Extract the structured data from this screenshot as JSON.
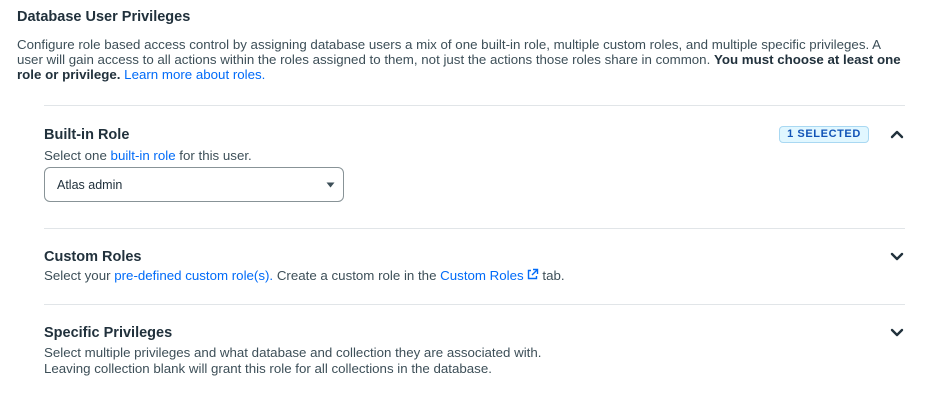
{
  "page": {
    "title": "Database User Privileges",
    "description_part1": "Configure role based access control by assigning database users a mix of one built-in role, multiple custom roles, and multiple specific privileges. A user will gain access to all actions within the roles assigned to them, not just the actions those roles share in common.",
    "description_bold": "You must choose at least one role or privilege.",
    "learn_more_link": "Learn more about roles."
  },
  "builtin_role": {
    "title": "Built-in Role",
    "sub_prefix": "Select one",
    "sub_link": "built-in role",
    "sub_suffix": "for this user.",
    "badge": "1 SELECTED",
    "expanded": true,
    "select_value": "Atlas admin"
  },
  "custom_roles": {
    "title": "Custom Roles",
    "sub_prefix": "Select your",
    "sub_link": "pre-defined custom role(s).",
    "sub_middle": "Create a custom role in the",
    "sub_link2": "Custom Roles",
    "sub_suffix": "tab.",
    "expanded": false
  },
  "specific_privileges": {
    "title": "Specific Privileges",
    "line1": "Select multiple privileges and what database and collection they are associated with.",
    "line2": "Leaving collection blank will grant this role for all collections in the database.",
    "expanded": false
  },
  "colors": {
    "link": "#016bf8",
    "badge_bg": "#e1f7ff",
    "badge_text": "#1254b7",
    "heading": "#21313c",
    "body_text": "#3d4f58"
  }
}
